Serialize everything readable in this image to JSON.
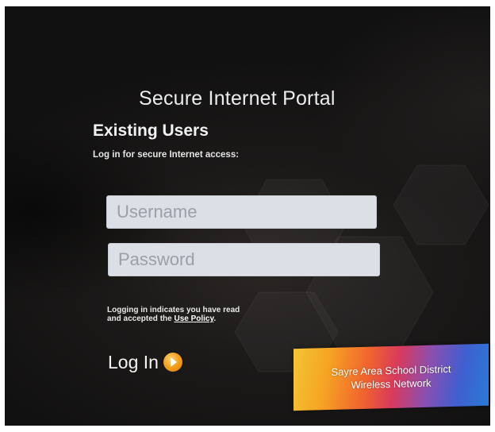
{
  "portal": {
    "title": "Secure Internet Portal",
    "section_heading": "Existing Users",
    "instructions": "Log in for secure Internet access:"
  },
  "form": {
    "username_placeholder": "Username",
    "password_placeholder": "Password",
    "username_value": "",
    "password_value": ""
  },
  "legal": {
    "line1": "Logging in indicates you have read",
    "line2_prefix": "and accepted the ",
    "policy_link": "Use Policy",
    "line2_suffix": "."
  },
  "login": {
    "label": "Log In",
    "icon": "arrow-right-circle-icon"
  },
  "banner": {
    "line1": "Sayre Area School District",
    "line2": "Wireless Network"
  },
  "colors": {
    "background": "#1c1a19",
    "text": "#f2f2f2",
    "field": "#dcdfe6",
    "login_icon": "#f5a21e"
  }
}
